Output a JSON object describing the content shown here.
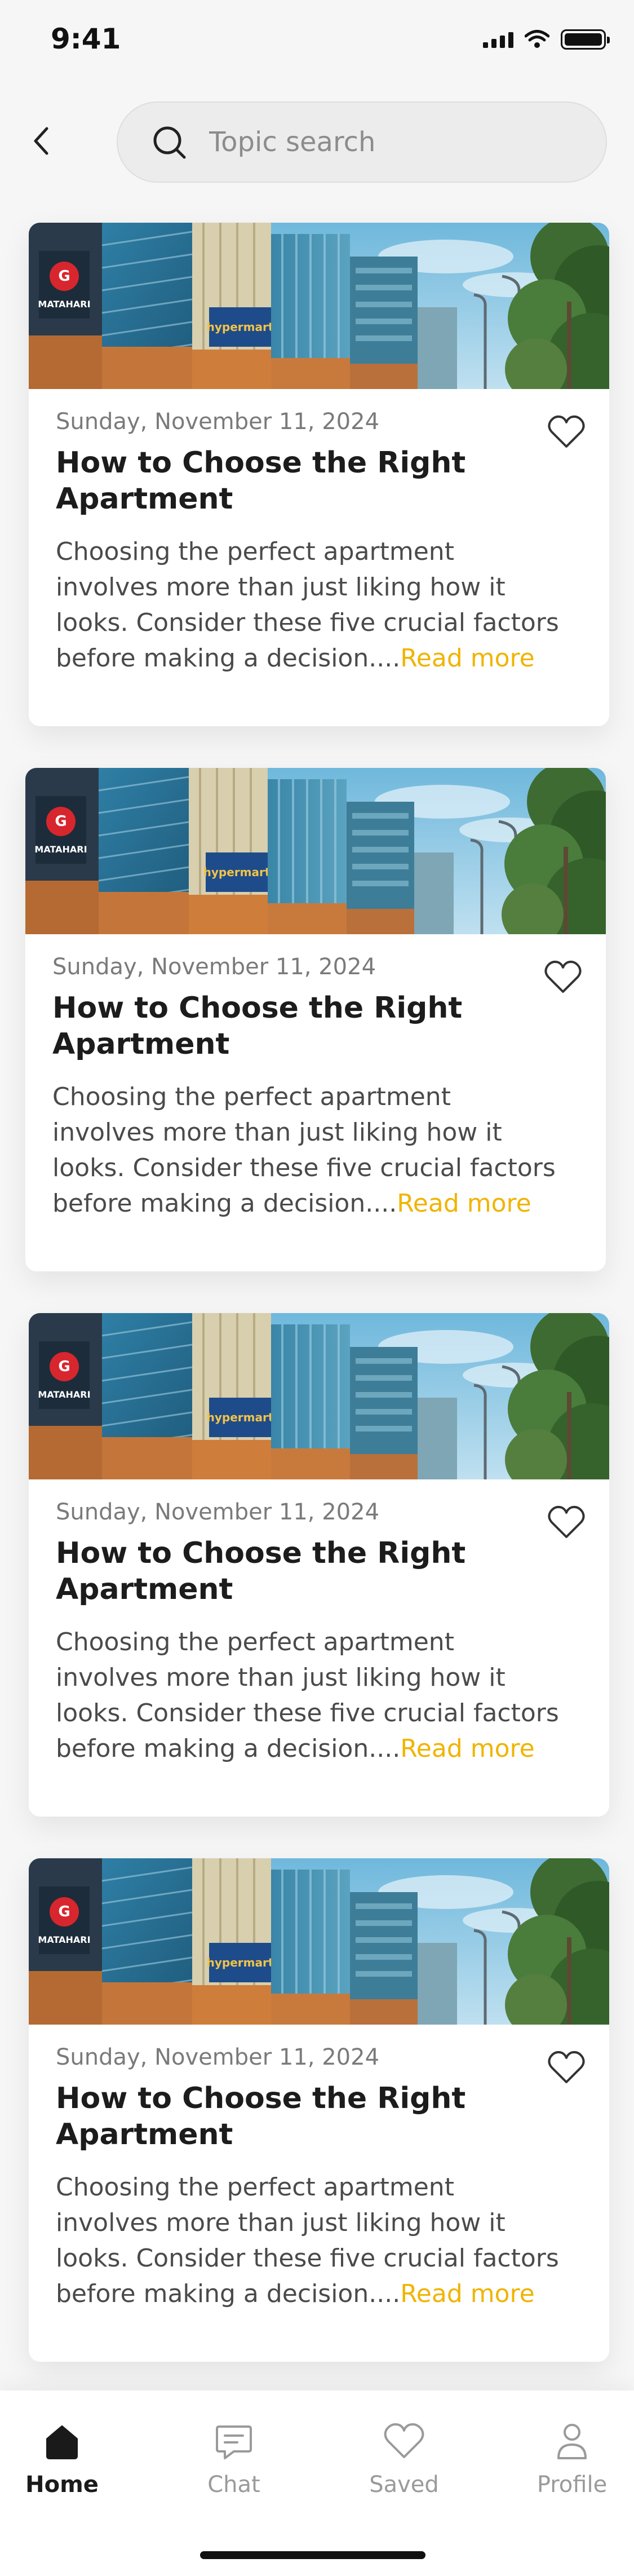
{
  "status_bar": {
    "time": "9:41",
    "icons": [
      "cellular-signal-icon",
      "wifi-icon",
      "battery-icon"
    ]
  },
  "header": {
    "back_icon": "chevron-left-icon",
    "search": {
      "placeholder": "Topic search",
      "value": "",
      "icon": "search-icon"
    }
  },
  "articles": [
    {
      "date": "Sunday, November 11, 2024",
      "title": "How to Choose the Right Apartment",
      "excerpt": "Choosing the perfect apartment involves more than just liking how it looks. Consider these five crucial factors before making a decision....",
      "read_more": "Read more",
      "image_alt": "Building facade photo",
      "saved": false
    },
    {
      "date": "Sunday, November 11, 2024",
      "title": "How to Choose the Right Apartment",
      "excerpt": "Choosing the perfect apartment involves more than just liking how it looks. Consider these five crucial factors before making a decision....",
      "read_more": "Read more",
      "image_alt": "Building facade photo",
      "saved": false
    },
    {
      "date": "Sunday, November 11, 2024",
      "title": "How to Choose the Right Apartment",
      "excerpt": "Choosing the perfect apartment involves more than just liking how it looks. Consider these five crucial factors before making a decision....",
      "read_more": "Read more",
      "image_alt": "Building facade photo",
      "saved": false
    },
    {
      "date": "Sunday, November 11, 2024",
      "title": "How to Choose the Right Apartment",
      "excerpt": "Choosing the perfect apartment involves more than just liking how it looks. Consider these five crucial factors before making a decision....",
      "read_more": "Read more",
      "image_alt": "Building facade photo",
      "saved": false
    }
  ],
  "bottom_nav": {
    "items": [
      {
        "label": "Home",
        "icon": "home-icon",
        "active": true
      },
      {
        "label": "Chat",
        "icon": "chat-icon",
        "active": false
      },
      {
        "label": "Saved",
        "icon": "heart-icon",
        "active": false
      },
      {
        "label": "Profile",
        "icon": "user-icon",
        "active": false
      }
    ]
  },
  "colors": {
    "accent": "#f0b400",
    "background": "#f6f6f6",
    "card": "#ffffff",
    "text_primary": "#1c1c1c",
    "text_secondary": "#7a7a7a"
  }
}
